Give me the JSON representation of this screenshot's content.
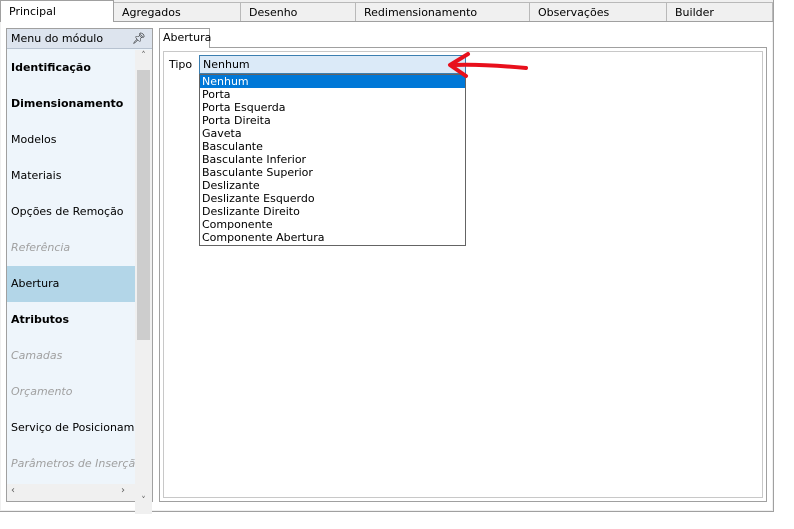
{
  "top_tabs": [
    "Principal",
    "Agregados",
    "Desenho",
    "Redimensionamento",
    "Observações",
    "Builder"
  ],
  "sidebar": {
    "title": "Menu do módulo",
    "pin_icon": "pin-icon",
    "items": [
      {
        "label": "Identificação",
        "style": "bold"
      },
      {
        "label": "Dimensionamento",
        "style": "bold"
      },
      {
        "label": "Modelos",
        "style": "normal"
      },
      {
        "label": "Materiais",
        "style": "normal"
      },
      {
        "label": "Opções de Remoção",
        "style": "normal"
      },
      {
        "label": "Referência",
        "style": "disabled"
      },
      {
        "label": "Abertura",
        "style": "selected"
      },
      {
        "label": "Atributos",
        "style": "bold"
      },
      {
        "label": "Camadas",
        "style": "disabled"
      },
      {
        "label": "Orçamento",
        "style": "disabled"
      },
      {
        "label": "Serviço de Posicionamento",
        "style": "normal"
      },
      {
        "label": "Parâmetros de Inserção",
        "style": "disabled"
      }
    ]
  },
  "inner_tab": "Abertura",
  "form": {
    "tipo_label": "Tipo",
    "tipo_value": "Nenhum",
    "options": [
      "Nenhum",
      "Porta",
      "Porta Esquerda",
      "Porta Direita",
      "Gaveta",
      "Basculante",
      "Basculante Inferior",
      "Basculante Superior",
      "Deslizante",
      "Deslizante Esquerdo",
      "Deslizante Direito",
      "Componente",
      "Componente Abertura"
    ]
  },
  "colors": {
    "selection": "#0078d7",
    "sidebar_selected": "#b3d6e8",
    "annotation_arrow": "#e8101c"
  }
}
